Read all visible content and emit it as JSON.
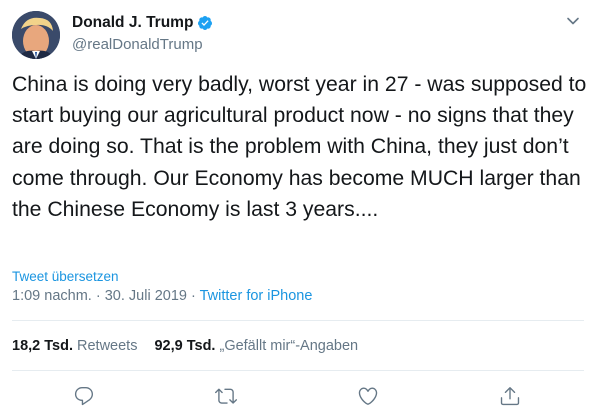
{
  "tweet": {
    "author_name": "Donald J. Trump",
    "handle": "@realDonaldTrump",
    "text": "China is doing very badly, worst year in 27 - was supposed to start buying our agricultural product now - no signs that they are doing so. That is the problem with China, they just don’t come through. Our Economy has become MUCH larger than the Chinese Economy is last 3 years....",
    "translate_label": "Tweet übersetzen",
    "time": "1:09 nachm.",
    "separator": "·",
    "date": "30. Juli 2019",
    "source": "Twitter for iPhone",
    "retweets_count": "18,2 Tsd.",
    "retweets_label": "Retweets",
    "likes_count": "92,9 Tsd.",
    "likes_label": "„Gefällt mir“-Angaben"
  },
  "icons": {
    "verified": "verified-badge-icon",
    "caret": "chevron-down-icon",
    "reply": "reply-icon",
    "retweet": "retweet-icon",
    "like": "heart-icon",
    "share": "share-icon"
  },
  "colors": {
    "text": "#14171a",
    "secondary": "#657786",
    "link": "#1b95e0",
    "divider": "#e6ecf0"
  }
}
